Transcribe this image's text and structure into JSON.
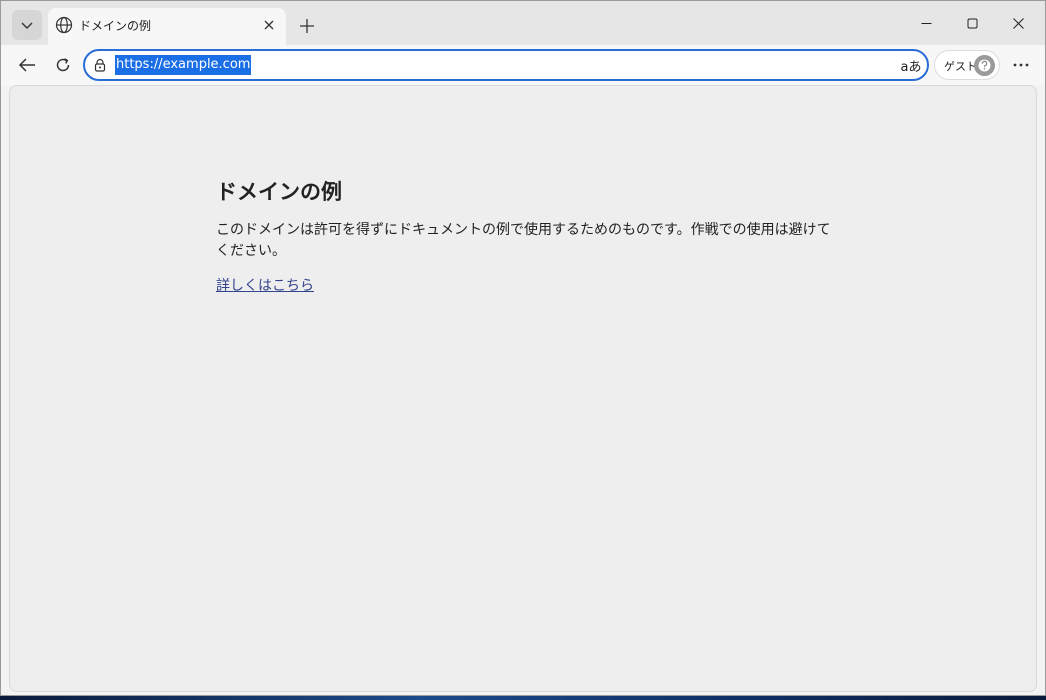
{
  "browser": {
    "tab": {
      "title": "ドメインの例"
    },
    "addressbar": {
      "url": "https://example.com",
      "read_aloud_glyph": "aあ"
    },
    "profile": {
      "label": "ゲスト"
    },
    "accent_color": "#2a6cd6",
    "selection_color": "#1a6ee6"
  },
  "page": {
    "heading": "ドメインの例",
    "body": "このドメインは許可を得ずにドキュメントの例で使用するためのものです。作戦での使用は避けてください。",
    "link_text": "詳しくはこちら",
    "link_color": "#33448d"
  },
  "icons": {
    "tab_list": "chevron-down-icon",
    "favicon": "globe-icon",
    "tab_close": "close-icon",
    "new_tab": "plus-icon",
    "back": "arrow-left-icon",
    "reload": "reload-icon",
    "lock": "lock-icon",
    "profile_avatar": "guest-avatar-icon",
    "more": "more-horizontal-icon",
    "minimize": "minimize-icon",
    "maximize": "maximize-icon",
    "close_window": "close-window-icon"
  }
}
